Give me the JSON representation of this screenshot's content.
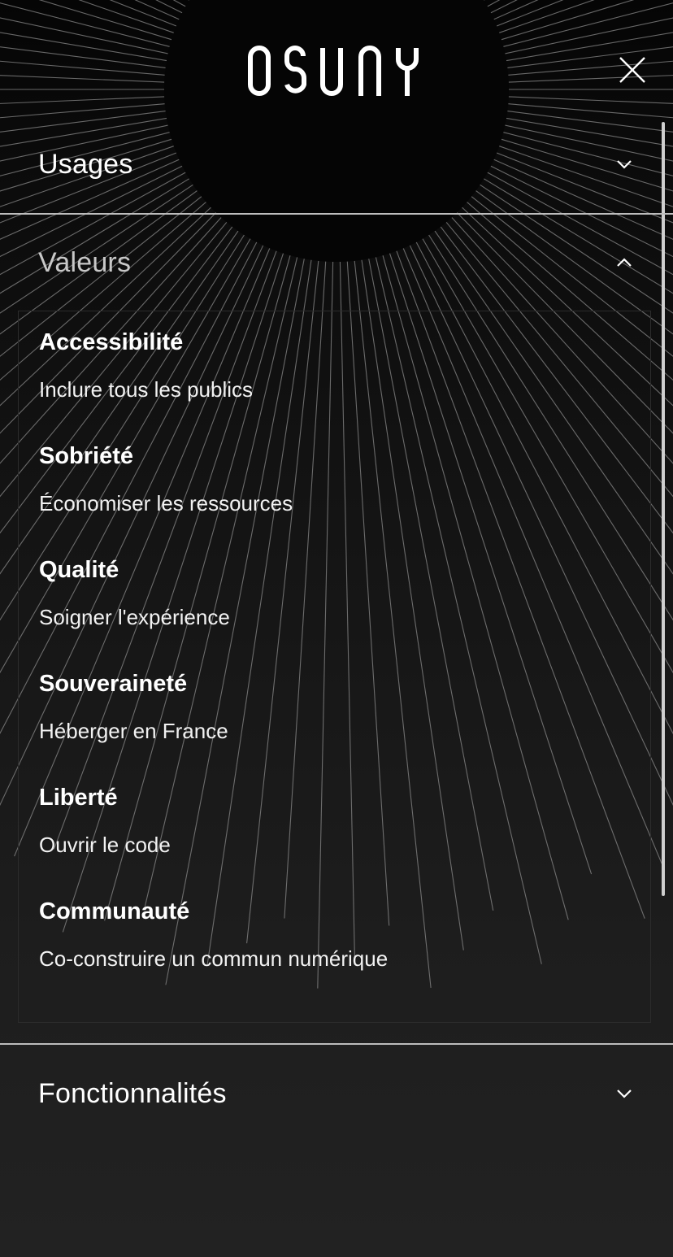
{
  "header": {
    "logo_text": "OSUNY",
    "close_icon": "close-icon"
  },
  "menu": {
    "usages": {
      "label": "Usages",
      "icon": "chevron-down-icon",
      "expanded": false
    },
    "valeurs": {
      "label": "Valeurs",
      "icon": "chevron-up-icon",
      "expanded": true,
      "items": [
        {
          "title": "Accessibilité",
          "desc": "Inclure tous les publics"
        },
        {
          "title": "Sobriété",
          "desc": "Économiser les ressources"
        },
        {
          "title": "Qualité",
          "desc": "Soigner l'expérience"
        },
        {
          "title": "Souveraineté",
          "desc": "Héberger en France"
        },
        {
          "title": "Liberté",
          "desc": "Ouvrir le code"
        },
        {
          "title": "Communauté",
          "desc": "Co-construire un commun numérique"
        }
      ]
    },
    "fonctionnalites": {
      "label": "Fonctionnalités",
      "icon": "chevron-down-icon",
      "expanded": false
    }
  },
  "colors": {
    "background_top": "#050505",
    "background_bottom": "#222222",
    "text": "#ffffff",
    "text_muted": "#c8c8c8",
    "divider": "#bdbdbd",
    "rays": "#8a8a8a"
  }
}
